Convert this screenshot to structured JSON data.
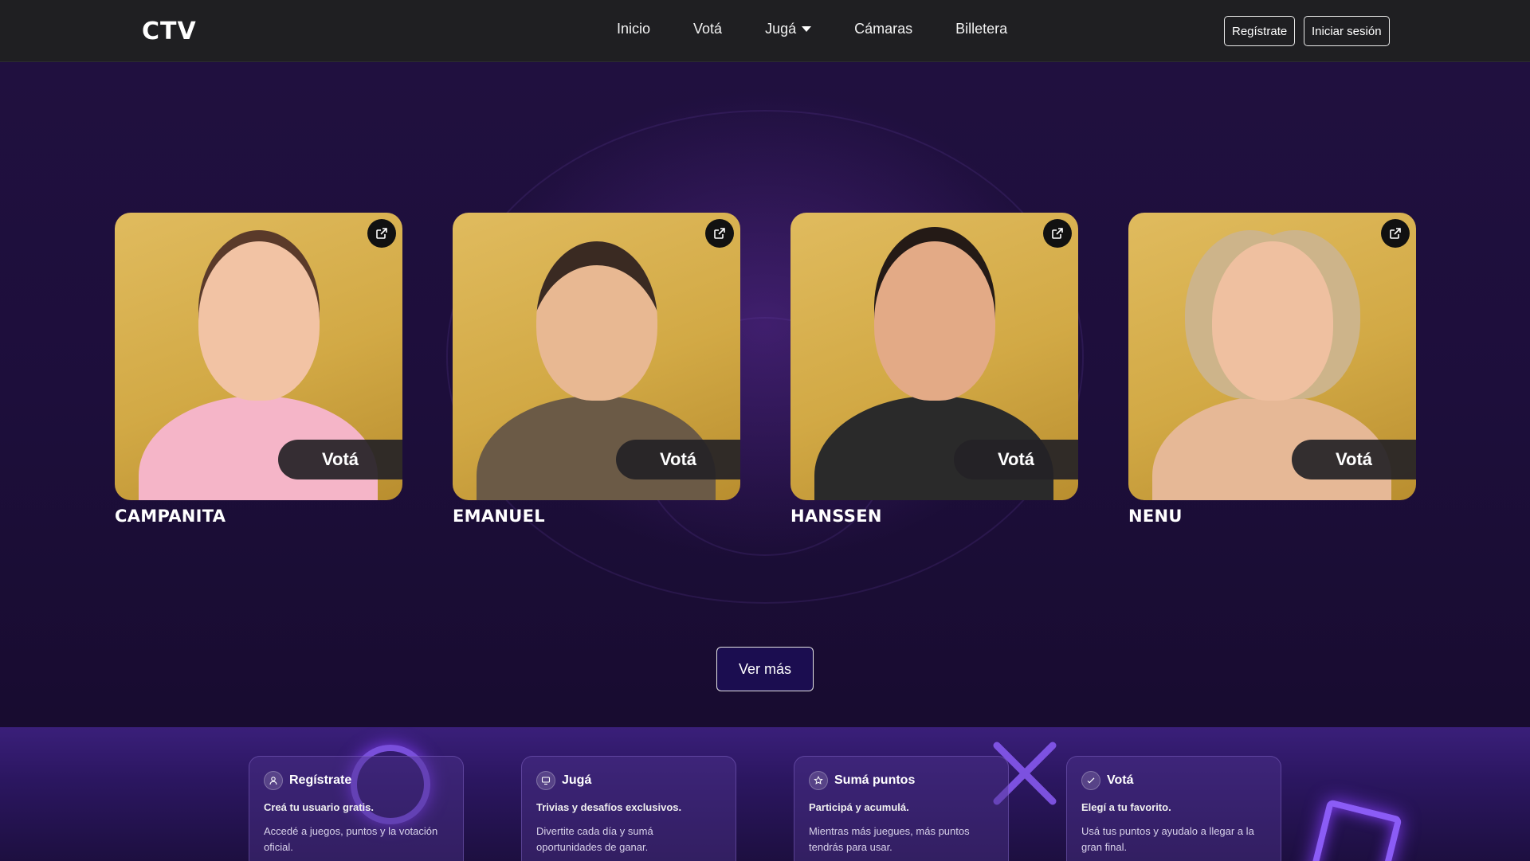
{
  "header": {
    "logo": "CTV",
    "nav": [
      {
        "label": "Inicio"
      },
      {
        "label": "Votá"
      },
      {
        "label": "Jugá",
        "has_caret": true
      },
      {
        "label": "Cámaras"
      },
      {
        "label": "Billetera"
      }
    ],
    "register_label": "Regístrate",
    "login_label": "Iniciar sesión"
  },
  "contestants": [
    {
      "name": "CAMPANITA",
      "vote_label": "Votá",
      "hair": "#5a3a2a",
      "skin": "#f2c3a4",
      "top": "#f5b5c8"
    },
    {
      "name": "EMANUEL",
      "vote_label": "Votá",
      "hair": "#3a2a22",
      "skin": "#e8b892",
      "top": "#6b5a46"
    },
    {
      "name": "HANSSEN",
      "vote_label": "Votá",
      "hair": "#241a16",
      "skin": "#e3aa86",
      "top": "#2a2a2a"
    },
    {
      "name": "NENU",
      "vote_label": "Votá",
      "hair": "#cdb48a",
      "skin": "#efc0a0",
      "top": "#e6b896"
    }
  ],
  "see_more_label": "Ver más",
  "features": [
    {
      "icon": "user-icon",
      "title": "Regístrate",
      "subtitle": "Creá tu usuario gratis.",
      "description": "Accedé a juegos, puntos y la votación oficial."
    },
    {
      "icon": "monitor-icon",
      "title": "Jugá",
      "subtitle": "Trivias y desafíos exclusivos.",
      "description": "Divertite cada día y sumá oportunidades de ganar."
    },
    {
      "icon": "star-icon",
      "title": "Sumá puntos",
      "subtitle": "Participá y acumulá.",
      "description": "Mientras más juegues, más puntos tendrás para usar."
    },
    {
      "icon": "vote-icon",
      "title": "Votá",
      "subtitle": "Elegí a tu favorito.",
      "description": "Usá tus puntos y ayudalo a llegar a la gran final."
    }
  ],
  "colors": {
    "nav_bg": "#1f1f22",
    "hero_bg": "#1d0e3b",
    "card_gold": "#d2a945",
    "vote_pill": "#242226",
    "see_more_bg": "#1b0d50",
    "neon": "#8b5cf6"
  }
}
